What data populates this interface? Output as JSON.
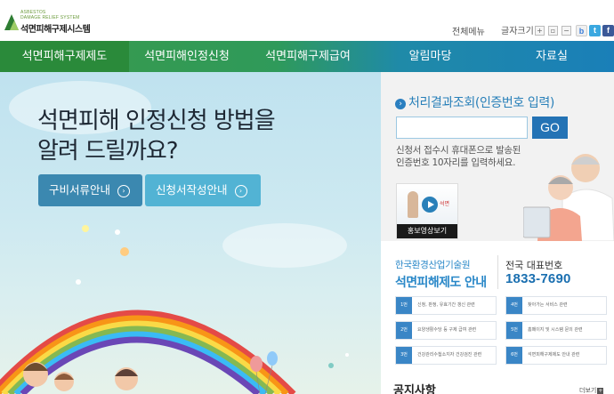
{
  "logo": {
    "line1": "ASBESTOS",
    "line2": "DAMAGE RELIEF SYSTEM",
    "title": "석면피해구제시스템"
  },
  "utility": {
    "all_menu": "전체메뉴",
    "font_size_label": "글자크기",
    "font_buttons": [
      "+",
      "▫",
      "−"
    ],
    "sns": [
      "b",
      "t",
      "f"
    ]
  },
  "nav": {
    "items": [
      "석면피해구제제도",
      "석면피해인정신청",
      "석면피해구제급여",
      "알림마당",
      "자료실"
    ]
  },
  "hero": {
    "line1": "석면피해 인정신청 방법을",
    "line2": "알려 드릴까요?",
    "btn_documents": "구비서류안내",
    "btn_form": "신청서작성안내"
  },
  "result_lookup": {
    "title": "처리결과조회(인증번호 입력)",
    "input_placeholder": "",
    "go_label": "GO",
    "desc_line1": "신청서 접수시 휴대폰으로 발송된",
    "desc_line2": "인증번호 10자리를 입력하세요.",
    "video_caption": "홍보영상보기",
    "video_logo": "석면"
  },
  "info": {
    "org": "한국환경산업기술원",
    "institution": "석면피해제도 안내",
    "hotline_label": "전국 대표번호",
    "hotline_number": "1833-7690",
    "ars": [
      {
        "num": "1번",
        "text": "신청, 판정, 유효기간 갱신 관련"
      },
      {
        "num": "4번",
        "text": "찾아가는 서비스 관련"
      },
      {
        "num": "2번",
        "text": "요양생활수당 등 구제 급여 관련"
      },
      {
        "num": "5번",
        "text": "홈페이지 및 시스템 문의 관련"
      },
      {
        "num": "3번",
        "text": "건강관리수첩소지자 건강검진 관련"
      },
      {
        "num": "6번",
        "text": "석면피해구제제도 안내 관련"
      }
    ]
  },
  "notice": {
    "title": "공지사항",
    "more": "더보기"
  },
  "colors": {
    "nav_green": "#3a9a4a",
    "nav_blue": "#1a7fb8",
    "accent_blue": "#2a88c8",
    "hero_btn_dark": "#3b88b0",
    "hero_btn_light": "#52b3d4"
  }
}
